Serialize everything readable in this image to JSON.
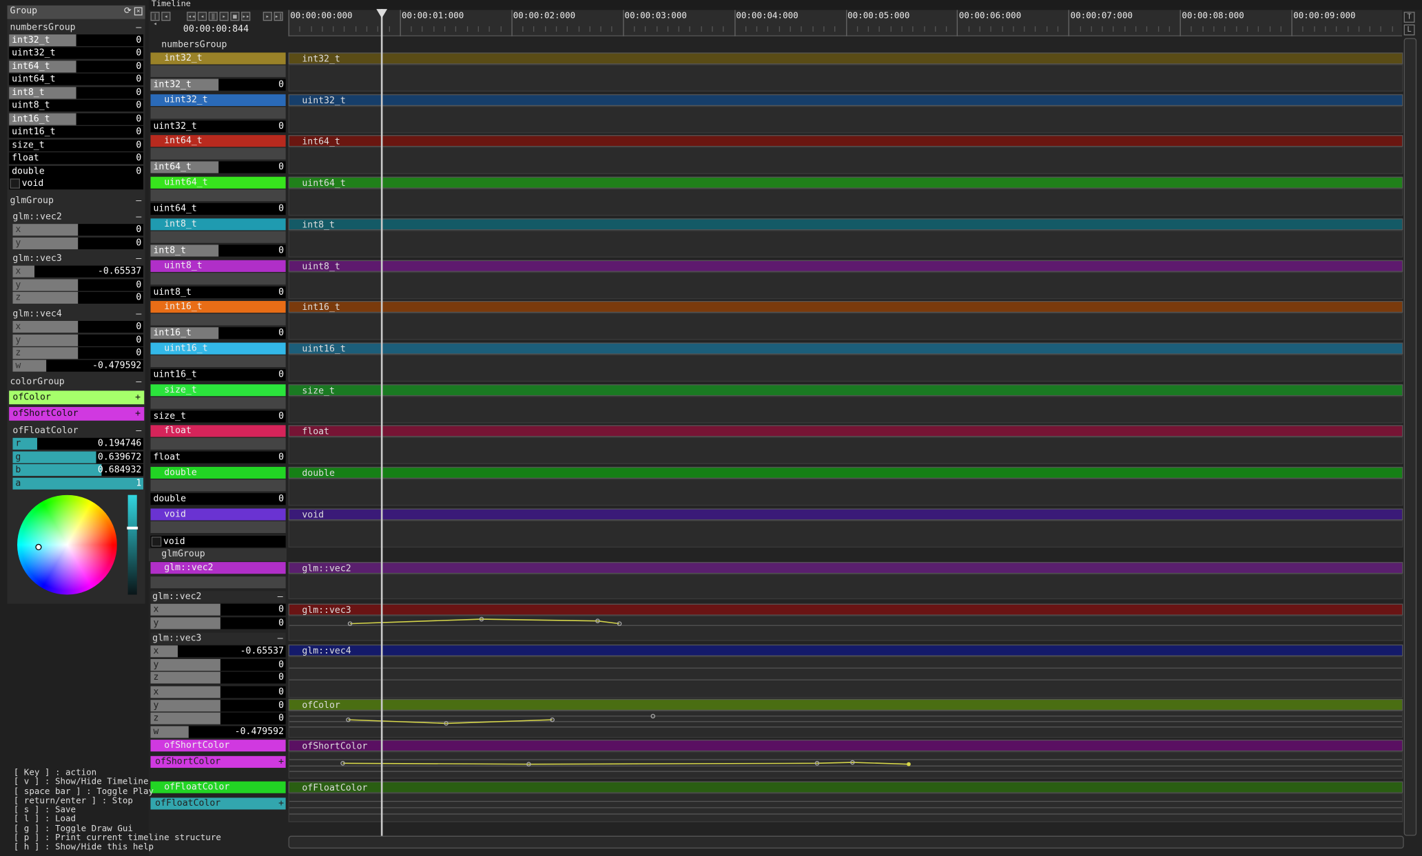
{
  "gui": {
    "title": "Group",
    "numbersGroup": {
      "title": "numbersGroup",
      "items": [
        {
          "label": "int32_t",
          "value": "0",
          "fill": 0.5
        },
        {
          "label": "uint32_t",
          "value": "0",
          "fill": 0
        },
        {
          "label": "int64_t",
          "value": "0",
          "fill": 0.5
        },
        {
          "label": "uint64_t",
          "value": "0",
          "fill": 0
        },
        {
          "label": "int8_t",
          "value": "0",
          "fill": 0.5
        },
        {
          "label": "uint8_t",
          "value": "0",
          "fill": 0
        },
        {
          "label": "int16_t",
          "value": "0",
          "fill": 0.5
        },
        {
          "label": "uint16_t",
          "value": "0",
          "fill": 0
        },
        {
          "label": "size_t",
          "value": "0",
          "fill": 0
        },
        {
          "label": "float",
          "value": "0",
          "fill": 0
        },
        {
          "label": "double",
          "value": "0",
          "fill": 0
        }
      ],
      "void_label": "void"
    },
    "glmGroup": {
      "title": "glmGroup",
      "vec2": {
        "title": "glm::vec2",
        "x": "0",
        "y": "0"
      },
      "vec3": {
        "title": "glm::vec3",
        "x": "-0.65537",
        "y": "0",
        "z": "0"
      },
      "vec4": {
        "title": "glm::vec4",
        "x": "0",
        "y": "0",
        "z": "0",
        "w": "-0.479592"
      }
    },
    "colorGroup": {
      "title": "colorGroup",
      "ofColor": "ofColor",
      "ofShortColor": "ofShortColor",
      "ofFloatColor": {
        "title": "ofFloatColor",
        "r": "0.194746",
        "g": "0.639672",
        "b": "0.684932",
        "a": "1"
      }
    },
    "minus": "–",
    "plus": "+"
  },
  "timeline": {
    "title": "Timeline",
    "time": "00:00:00:844",
    "ruler": [
      "00:00:00:000",
      "00:00:01:000",
      "00:00:02:000",
      "00:00:03:000",
      "00:00:04:000",
      "00:00:05:000",
      "00:00:06:000",
      "00:00:07:000",
      "00:00:08:000",
      "00:00:09:000"
    ],
    "numbersGroup": "numbersGroup",
    "glmGroup": "glmGroup",
    "tracks": [
      {
        "name": "int32_t",
        "value": "0"
      },
      {
        "name": "uint32_t",
        "value": "0"
      },
      {
        "name": "int64_t",
        "value": "0"
      },
      {
        "name": "uint64_t",
        "value": "0"
      },
      {
        "name": "int8_t",
        "value": "0"
      },
      {
        "name": "uint8_t",
        "value": "0"
      },
      {
        "name": "int16_t",
        "value": "0"
      },
      {
        "name": "uint16_t",
        "value": "0"
      },
      {
        "name": "size_t",
        "value": "0"
      },
      {
        "name": "float",
        "value": "0"
      },
      {
        "name": "double",
        "value": "0"
      },
      {
        "name": "void",
        "value": ""
      }
    ],
    "glm": {
      "vec2": {
        "name": "glm::vec2",
        "x": "0",
        "y": "0"
      },
      "vec3": {
        "name": "glm::vec3",
        "x": "-0.65537",
        "y": "0",
        "z": "0"
      },
      "vec4": {
        "name": "glm::vec4",
        "x": "0",
        "y": "0",
        "z": "0",
        "w": "-0.479592"
      }
    },
    "colors": {
      "ofColor": "ofColor",
      "ofShortColor": "ofShortColor",
      "ofFloatColor": "ofFloatColor"
    },
    "axis": {
      "x": "x",
      "y": "y",
      "z": "z",
      "w": "w"
    }
  },
  "help": [
    "[ Key ] : action",
    "[ v ] : Show/Hide Timeline",
    "[ space bar ] : Toggle Play",
    "[ return/enter ] : Stop",
    "[ s ] : Save",
    "[ l ] : Load",
    "[ g ] : Toggle Draw Gui",
    "[ p ] : Print current timeline structure",
    "[ h ] : Show/Hide this help"
  ],
  "colors": {
    "int32_t": "#9a8228",
    "uint32_t": "#2a6ab8",
    "int64_t": "#b82a1e",
    "uint64_t": "#37e41d",
    "int8_t": "#1f9bb0",
    "uint8_t": "#b02fc8",
    "int16_t": "#e86d16",
    "uint16_t": "#33b8e8",
    "size_t": "#2be43c",
    "float": "#d6245a",
    "double": "#22d424",
    "void": "#6a33d2",
    "ofColor": "#a6ff6b",
    "ofShortColor": "#d039e0",
    "ofFloatColor": "#32a6ae"
  }
}
